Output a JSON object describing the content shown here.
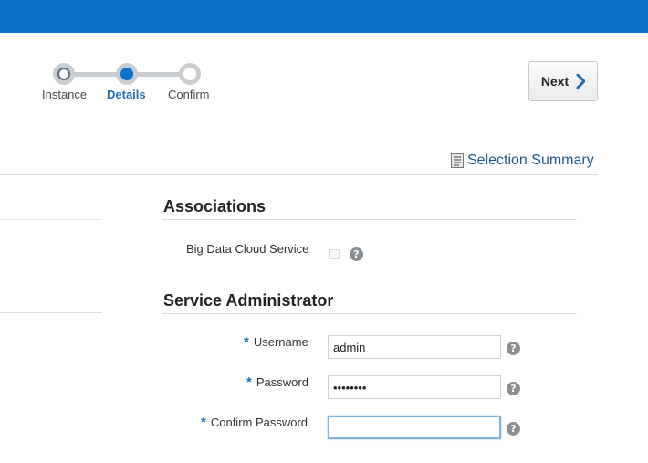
{
  "train": {
    "stops": [
      {
        "label": "Instance",
        "state": "visited"
      },
      {
        "label": "Details",
        "state": "current"
      },
      {
        "label": "Confirm",
        "state": "unvisited"
      }
    ]
  },
  "toolbar": {
    "next_label": "Next"
  },
  "selection_summary": {
    "label": "Selection Summary",
    "icon": "summary-doc-icon"
  },
  "associations": {
    "title": "Associations",
    "fields": [
      {
        "label": "Big Data Cloud Service",
        "checked": false
      }
    ]
  },
  "service_admin": {
    "title": "Service Administrator",
    "required_marker": "*",
    "username": {
      "label": "Username",
      "value": "admin"
    },
    "password": {
      "label": "Password",
      "value": "••••••••"
    },
    "confirm_password": {
      "label": "Confirm Password",
      "value": ""
    }
  },
  "help_glyph": "?",
  "colors": {
    "header": "#0a72c9",
    "accent": "#1f6fb6",
    "link": "#1c5a8f"
  }
}
